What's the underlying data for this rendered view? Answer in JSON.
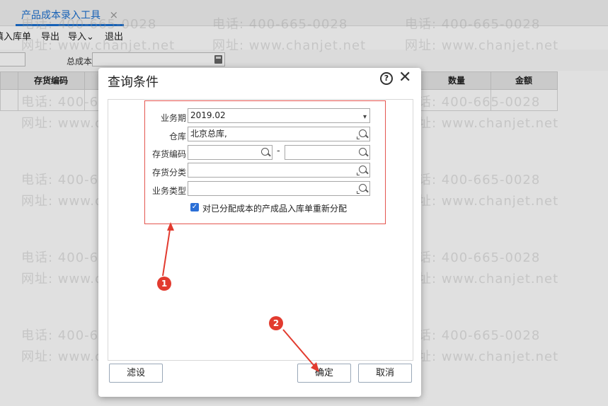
{
  "tab": {
    "title": "产品成本录入工具",
    "close": "×"
  },
  "toolbar": {
    "items": [
      "填入库单",
      "导出",
      "导入",
      "退出"
    ],
    "import_chevron": "⌄"
  },
  "filter": {
    "total_cost_label": "总成本"
  },
  "grid": {
    "headers": [
      "存货编码",
      "数量",
      "金额"
    ]
  },
  "watermark": {
    "phone": "电话: 400-665-0028",
    "site": "网址: www.chanjet.net"
  },
  "dialog": {
    "title": "查询条件",
    "help": "?",
    "close": "✕",
    "fields": {
      "period_label": "业务期",
      "period_value": "2019.02",
      "warehouse_label": "仓库",
      "warehouse_value": "北京总库,",
      "inv_code_label": "存货编码",
      "inv_class_label": "存货分类",
      "biz_type_label": "业务类型",
      "dash": "-"
    },
    "checkbox": {
      "label": "对已分配成本的产成品入库单重新分配",
      "checked": true,
      "mark": "✓"
    },
    "buttons": {
      "filter": "滤设",
      "ok": "确定",
      "cancel": "取消"
    }
  },
  "annotations": {
    "one": "1",
    "two": "2",
    "color": "#e23b2f"
  }
}
